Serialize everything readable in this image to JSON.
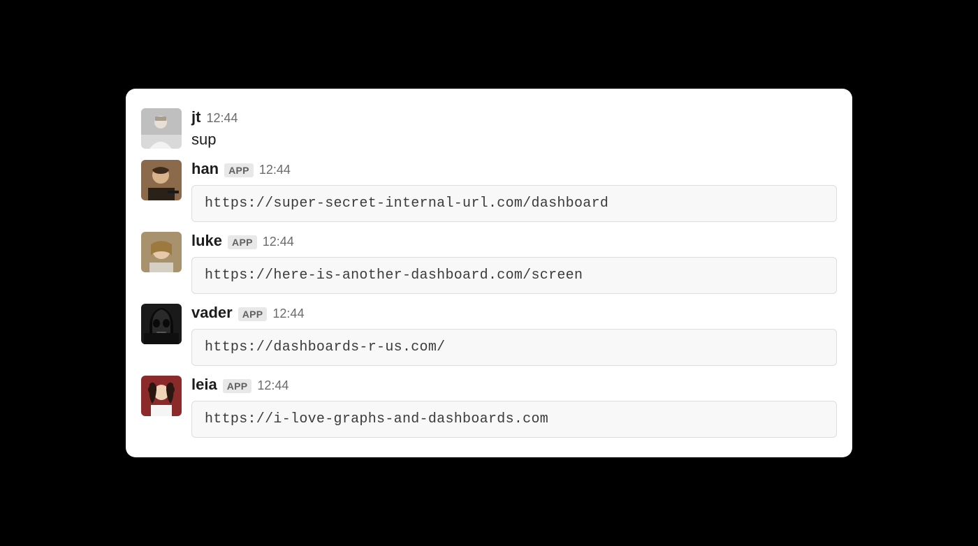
{
  "app_badge_label": "APP",
  "messages": [
    {
      "username": "jt",
      "timestamp": "12:44",
      "has_app_badge": false,
      "type": "text",
      "content": "sup",
      "avatar": "jt"
    },
    {
      "username": "han",
      "timestamp": "12:44",
      "has_app_badge": true,
      "type": "code",
      "content": "https://super-secret-internal-url.com/dashboard",
      "avatar": "han"
    },
    {
      "username": "luke",
      "timestamp": "12:44",
      "has_app_badge": true,
      "type": "code",
      "content": "https://here-is-another-dashboard.com/screen",
      "avatar": "luke"
    },
    {
      "username": "vader",
      "timestamp": "12:44",
      "has_app_badge": true,
      "type": "code",
      "content": "https://dashboards-r-us.com/",
      "avatar": "vader"
    },
    {
      "username": "leia",
      "timestamp": "12:44",
      "has_app_badge": true,
      "type": "code",
      "content": "https://i-love-graphs-and-dashboards.com",
      "avatar": "leia"
    }
  ]
}
